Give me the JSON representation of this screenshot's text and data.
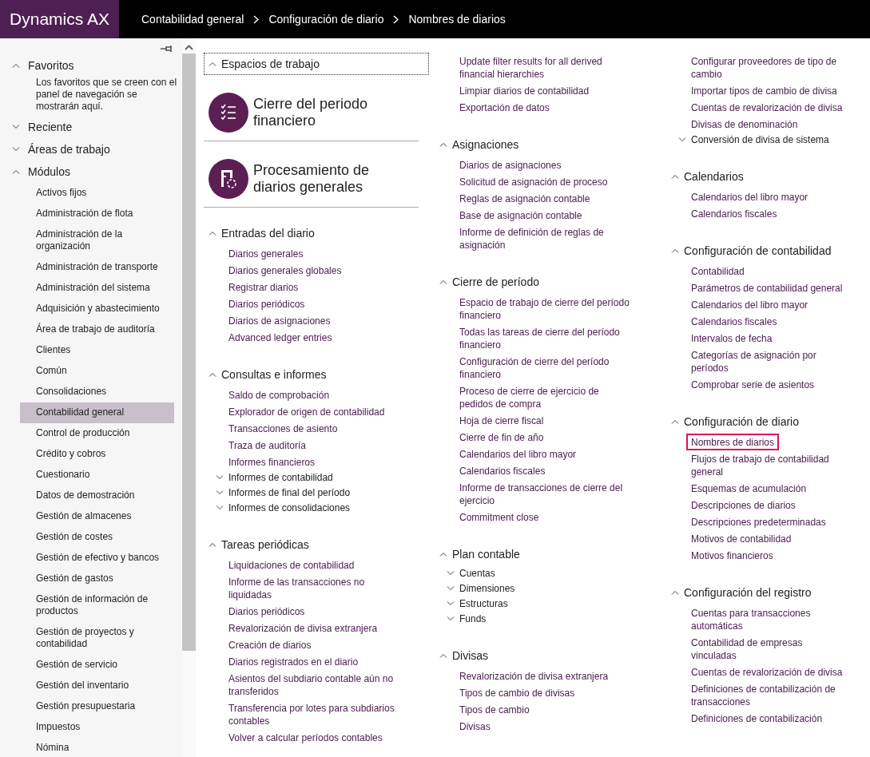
{
  "top_bar": {
    "brand": "Dynamics AX",
    "breadcrumbs": [
      "Contabilidad general",
      "Configuración de diario",
      "Nombres de diarios"
    ]
  },
  "nav_pane": {
    "sections": [
      {
        "title": "Favoritos",
        "expanded": true,
        "note": "Los favoritos que se creen con el panel de navegación se mostrarán aquí."
      },
      {
        "title": "Reciente",
        "expanded": false
      },
      {
        "title": "Áreas de trabajo",
        "expanded": false
      },
      {
        "title": "Módulos",
        "expanded": true,
        "items": [
          {
            "label": "Activos fijos",
            "selected": false
          },
          {
            "label": "Administración de flota",
            "selected": false
          },
          {
            "label": "Administración de la organización",
            "selected": false
          },
          {
            "label": "Administración de transporte",
            "selected": false
          },
          {
            "label": "Administración del sistema",
            "selected": false
          },
          {
            "label": "Adquisición y abastecimiento",
            "selected": false
          },
          {
            "label": "Área de trabajo de auditoría",
            "selected": false
          },
          {
            "label": "Clientes",
            "selected": false
          },
          {
            "label": "Común",
            "selected": false
          },
          {
            "label": "Consolidaciones",
            "selected": false
          },
          {
            "label": "Contabilidad general",
            "selected": true
          },
          {
            "label": "Control de producción",
            "selected": false
          },
          {
            "label": "Crédito y cobros",
            "selected": false
          },
          {
            "label": "Cuestionario",
            "selected": false
          },
          {
            "label": "Datos de demostración",
            "selected": false
          },
          {
            "label": "Gestión de almacenes",
            "selected": false
          },
          {
            "label": "Gestión de costes",
            "selected": false
          },
          {
            "label": "Gestión de efectivo y bancos",
            "selected": false
          },
          {
            "label": "Gestión de gastos",
            "selected": false
          },
          {
            "label": "Gestión de información de productos",
            "selected": false
          },
          {
            "label": "Gestión de proyectos y contabilidad",
            "selected": false
          },
          {
            "label": "Gestión de servicio",
            "selected": false
          },
          {
            "label": "Gestión del inventario",
            "selected": false
          },
          {
            "label": "Gestión presupuestaria",
            "selected": false
          },
          {
            "label": "Impuestos",
            "selected": false
          },
          {
            "label": "Nómina",
            "selected": false
          }
        ]
      }
    ]
  },
  "columns": [
    [
      {
        "kind": "workspaces",
        "title": "Espacios de trabajo",
        "expanded": true,
        "tiles": [
          {
            "label": "Cierre del periodo financiero"
          },
          {
            "label": "Procesamiento de diarios generales"
          }
        ]
      },
      {
        "kind": "section",
        "title": "Entradas del diario",
        "expanded": true,
        "items": [
          {
            "kind": "link",
            "label": "Diarios generales"
          },
          {
            "kind": "link",
            "label": "Diarios generales globales"
          },
          {
            "kind": "link",
            "label": "Registrar diarios"
          },
          {
            "kind": "link",
            "label": "Diarios periódicos"
          },
          {
            "kind": "link",
            "label": "Diarios de asignaciones"
          },
          {
            "kind": "link",
            "label": "Advanced ledger entries"
          }
        ]
      },
      {
        "kind": "section",
        "title": "Consultas e informes",
        "expanded": true,
        "items": [
          {
            "kind": "link",
            "label": "Saldo de comprobación"
          },
          {
            "kind": "link",
            "label": "Explorador de origen de contabilidad"
          },
          {
            "kind": "link",
            "label": "Transacciones de asiento"
          },
          {
            "kind": "link",
            "label": "Traza de auditoría"
          },
          {
            "kind": "link",
            "label": "Informes financieros"
          },
          {
            "kind": "group",
            "label": "Informes de contabilidad",
            "expanded": false
          },
          {
            "kind": "group",
            "label": "Informes de final del período",
            "expanded": false
          },
          {
            "kind": "group",
            "label": "Informes de consolidaciones",
            "expanded": false
          }
        ]
      },
      {
        "kind": "section",
        "title": "Tareas periódicas",
        "expanded": true,
        "items": [
          {
            "kind": "link",
            "label": "Liquidaciones de contabilidad"
          },
          {
            "kind": "link",
            "label": "Informe de las transacciones no liquidadas"
          },
          {
            "kind": "link",
            "label": "Diarios periódicos"
          },
          {
            "kind": "link",
            "label": "Revalorización de divisa extranjera"
          },
          {
            "kind": "link",
            "label": "Creación de diarios"
          },
          {
            "kind": "link",
            "label": "Diarios registrados en el diario"
          },
          {
            "kind": "link",
            "label": "Asientos del subdiario contable aún no transferidos"
          },
          {
            "kind": "link",
            "label": "Transferencia por lotes para subdiarios contables"
          },
          {
            "kind": "link",
            "label": "Volver a calcular períodos contables"
          }
        ]
      }
    ],
    [
      {
        "kind": "links",
        "items": [
          {
            "kind": "link",
            "label": "Update filter results for all derived financial hierarchies"
          },
          {
            "kind": "link",
            "label": "Limpiar diarios de contabilidad"
          },
          {
            "kind": "link",
            "label": "Exportación de datos"
          }
        ]
      },
      {
        "kind": "section",
        "title": "Asignaciones",
        "expanded": true,
        "items": [
          {
            "kind": "link",
            "label": "Diarios de asignaciones"
          },
          {
            "kind": "link",
            "label": "Solicitud de asignación de proceso"
          },
          {
            "kind": "link",
            "label": "Reglas de asignación contable"
          },
          {
            "kind": "link",
            "label": "Base de asignación contable"
          },
          {
            "kind": "link",
            "label": "Informe de definición de reglas de asignación"
          }
        ]
      },
      {
        "kind": "section",
        "title": "Cierre de período",
        "expanded": true,
        "items": [
          {
            "kind": "link",
            "label": "Espacio de trabajo de cierre del período financiero"
          },
          {
            "kind": "link",
            "label": "Todas las tareas de cierre del período financiero"
          },
          {
            "kind": "link",
            "label": "Configuración de cierre del período financiero"
          },
          {
            "kind": "link",
            "label": "Proceso de cierre de ejercicio de pedidos de compra"
          },
          {
            "kind": "link",
            "label": "Hoja de cierre fiscal"
          },
          {
            "kind": "link",
            "label": "Cierre de fin de año"
          },
          {
            "kind": "link",
            "label": "Calendarios del libro mayor"
          },
          {
            "kind": "link",
            "label": "Calendarios fiscales"
          },
          {
            "kind": "link",
            "label": "Informe de transacciones de cierre del ejercicio"
          },
          {
            "kind": "link",
            "label": "Commitment close"
          }
        ]
      },
      {
        "kind": "section",
        "title": "Plan contable",
        "expanded": true,
        "items": [
          {
            "kind": "group",
            "label": "Cuentas",
            "expanded": false
          },
          {
            "kind": "group",
            "label": "Dimensiones",
            "expanded": false
          },
          {
            "kind": "group",
            "label": "Estructuras",
            "expanded": false
          },
          {
            "kind": "group",
            "label": "Funds",
            "expanded": false
          }
        ]
      },
      {
        "kind": "section",
        "title": "Divisas",
        "expanded": true,
        "items": [
          {
            "kind": "link",
            "label": "Revalorización de divisa extranjera"
          },
          {
            "kind": "link",
            "label": "Tipos de cambio de divisas"
          },
          {
            "kind": "link",
            "label": "Tipos de cambio"
          },
          {
            "kind": "link",
            "label": "Divisas"
          }
        ]
      }
    ],
    [
      {
        "kind": "links",
        "items": [
          {
            "kind": "link",
            "label": "Configurar proveedores de tipo de cambio"
          },
          {
            "kind": "link",
            "label": "Importar tipos de cambio de divisa"
          },
          {
            "kind": "link",
            "label": "Cuentas de revalorización de divisa"
          },
          {
            "kind": "link",
            "label": "Divisas de denominación"
          },
          {
            "kind": "group",
            "label": "Conversión de divisa de sistema",
            "expanded": false
          }
        ]
      },
      {
        "kind": "section",
        "title": "Calendarios",
        "expanded": true,
        "items": [
          {
            "kind": "link",
            "label": "Calendarios del libro mayor"
          },
          {
            "kind": "link",
            "label": "Calendarios fiscales"
          }
        ]
      },
      {
        "kind": "section",
        "title": "Configuración de contabilidad",
        "expanded": true,
        "items": [
          {
            "kind": "link",
            "label": "Contabilidad"
          },
          {
            "kind": "link",
            "label": "Parámetros de contabilidad general"
          },
          {
            "kind": "link",
            "label": "Calendarios del libro mayor"
          },
          {
            "kind": "link",
            "label": "Calendarios fiscales"
          },
          {
            "kind": "link",
            "label": "Intervalos de fecha"
          },
          {
            "kind": "link",
            "label": "Categorías de asignación por períodos"
          },
          {
            "kind": "link",
            "label": "Comprobar serie de asientos"
          }
        ]
      },
      {
        "kind": "section",
        "title": "Configuración de diario",
        "expanded": true,
        "items": [
          {
            "kind": "link",
            "label": "Nombres de diarios",
            "highlighted": true
          },
          {
            "kind": "link",
            "label": "Flujos de trabajo de contabilidad general",
            "highlighted": false
          },
          {
            "kind": "link",
            "label": "Esquemas de acumulación",
            "highlighted": false
          },
          {
            "kind": "link",
            "label": "Descripciones de diarios",
            "highlighted": false
          },
          {
            "kind": "link",
            "label": "Descripciones predeterminadas",
            "highlighted": false
          },
          {
            "kind": "link",
            "label": "Motivos de contabilidad",
            "highlighted": false
          },
          {
            "kind": "link",
            "label": "Motivos financieros",
            "highlighted": false
          }
        ]
      },
      {
        "kind": "section",
        "title": "Configuración del registro",
        "expanded": true,
        "items": [
          {
            "kind": "link",
            "label": "Cuentas para transacciones automáticas"
          },
          {
            "kind": "link",
            "label": "Contabilidad de empresas vinculadas"
          },
          {
            "kind": "link",
            "label": "Cuentas de revalorización de divisa"
          },
          {
            "kind": "link",
            "label": "Definiciones de contabilización de transacciones"
          },
          {
            "kind": "link",
            "label": "Definiciones de contabilización"
          }
        ]
      }
    ]
  ]
}
